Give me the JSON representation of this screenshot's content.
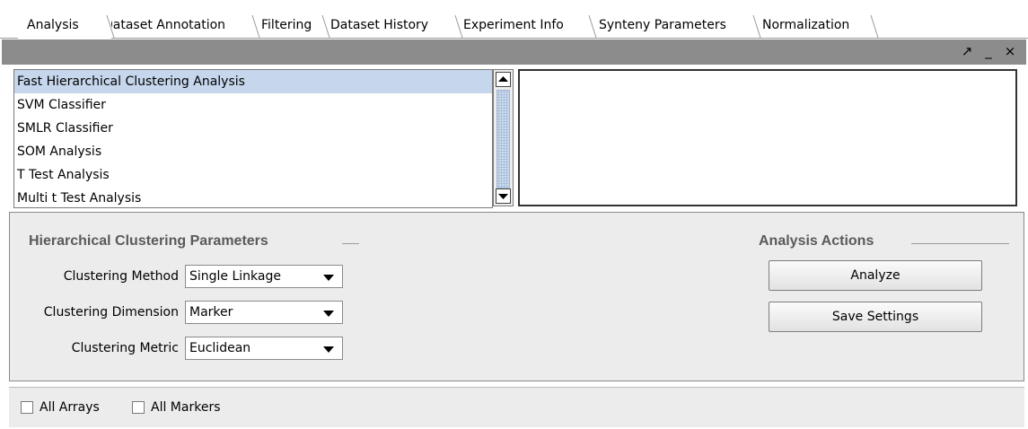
{
  "tabs": [
    {
      "label": "Analysis",
      "active": true
    },
    {
      "label": "Dataset Annotation",
      "active": false
    },
    {
      "label": "Filtering",
      "active": false
    },
    {
      "label": "Dataset History",
      "active": false
    },
    {
      "label": "Experiment Info",
      "active": false
    },
    {
      "label": "Synteny Parameters",
      "active": false
    },
    {
      "label": "Normalization",
      "active": false
    }
  ],
  "window_controls": {
    "maximize": "↗",
    "minimize": "_",
    "close": "×"
  },
  "analysis_list": {
    "items": [
      "Fast Hierarchical Clustering Analysis",
      "SVM Classifier",
      "SMLR Classifier",
      "SOM Analysis",
      "T Test Analysis",
      "Multi t Test Analysis"
    ],
    "selected_index": 0
  },
  "parameters": {
    "title": "Hierarchical Clustering Parameters",
    "fields": [
      {
        "label": "Clustering Method",
        "value": "Single Linkage"
      },
      {
        "label": "Clustering Dimension",
        "value": "Marker"
      },
      {
        "label": "Clustering Metric",
        "value": "Euclidean"
      }
    ]
  },
  "actions": {
    "title": "Analysis Actions",
    "analyze_label": "Analyze",
    "save_label": "Save Settings"
  },
  "bottom": {
    "all_arrays_label": "All Arrays",
    "all_arrays_checked": false,
    "all_markers_label": "All Markers",
    "all_markers_checked": false
  },
  "colors": {
    "selection": "#c6d6ec",
    "title_bar": "#8c8c8c",
    "panel_bg": "#ececec",
    "section_title": "#5a5a5a"
  }
}
